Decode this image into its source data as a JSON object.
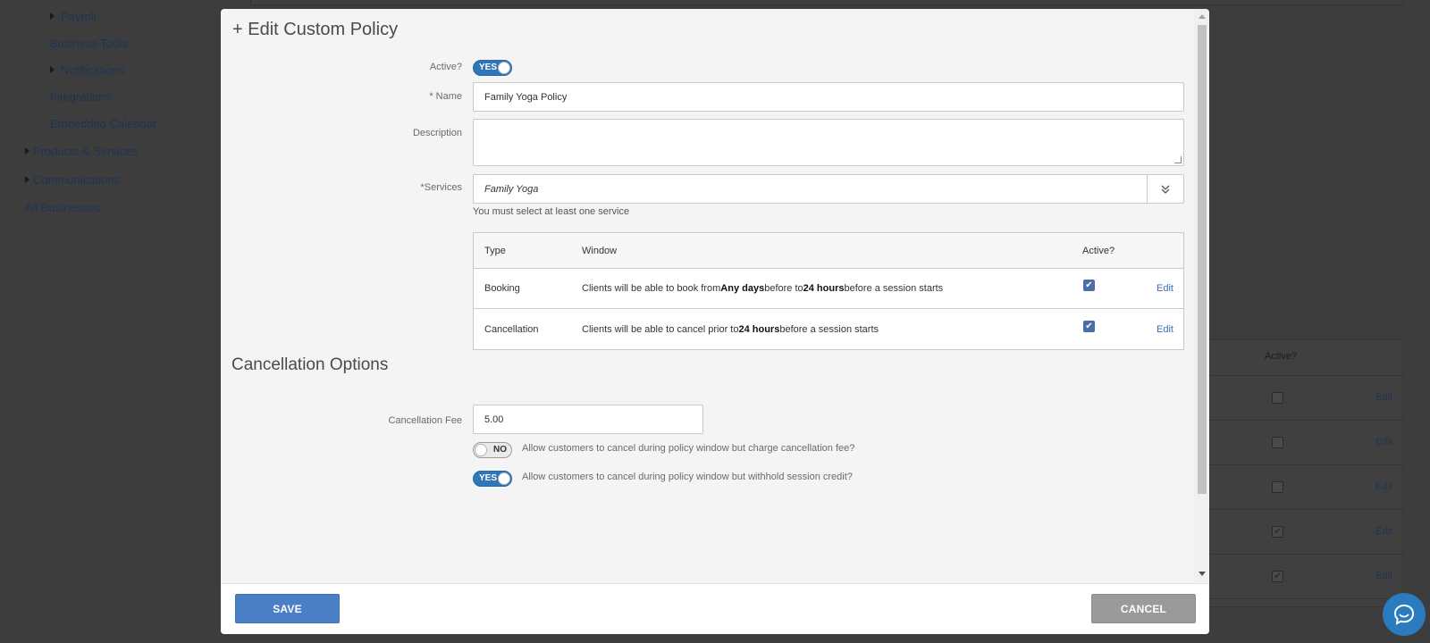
{
  "background": {
    "nav_items": [
      {
        "label": "Payroll",
        "expandable": true
      },
      {
        "label": "Business Tools",
        "expandable": false
      },
      {
        "label": "Notifications",
        "expandable": true
      },
      {
        "label": "Integrations",
        "expandable": false
      },
      {
        "label": "Embedded Calendar",
        "expandable": false
      },
      {
        "label": "Products & Services",
        "expandable": true
      },
      {
        "label": "Communications",
        "expandable": true
      },
      {
        "label": "All Businesses",
        "expandable": false
      }
    ],
    "table_header": "Active?",
    "rows": [
      {
        "checked": false,
        "edit": "Edit"
      },
      {
        "checked": false,
        "edit": "Edit"
      },
      {
        "checked": false,
        "edit": "Edit"
      },
      {
        "checked": true,
        "edit": "Edit"
      },
      {
        "checked": true,
        "edit": "Edit"
      }
    ]
  },
  "modal": {
    "title": "+ Edit Custom Policy",
    "active": {
      "label": "Active?",
      "value": "YES",
      "on": true
    },
    "name": {
      "label": "* Name",
      "value": "Family Yoga Policy"
    },
    "description": {
      "label": "Description",
      "value": ""
    },
    "services": {
      "label": "*Services",
      "value": "Family Yoga",
      "hint": "You must select at least one service",
      "dropdown_icon": "double-chevron-down-icon"
    },
    "policy_table": {
      "headers": {
        "type": "Type",
        "window": "Window",
        "active": "Active?"
      },
      "rows": [
        {
          "type": "Booking",
          "window_parts": [
            "Clients will be able to book from ",
            "Any days",
            " before to ",
            "24 hours",
            " before a session starts"
          ],
          "active": true,
          "edit": "Edit"
        },
        {
          "type": "Cancellation",
          "window_parts": [
            "Clients will be able to cancel prior to ",
            "24 hours",
            " before a session starts"
          ],
          "active": true,
          "edit": "Edit"
        }
      ]
    },
    "cancellation": {
      "section_title": "Cancellation Options",
      "fee_label": "Cancellation Fee",
      "fee_value": "5.00",
      "options": [
        {
          "toggle": "NO",
          "on": false,
          "text": "Allow customers to cancel during policy window but charge cancellation fee?"
        },
        {
          "toggle": "YES",
          "on": true,
          "text": "Allow customers to cancel during policy window but withhold session credit?"
        }
      ]
    },
    "footer": {
      "save": "SAVE",
      "cancel": "CANCEL"
    }
  },
  "colors": {
    "primary": "#4a7fc5",
    "toggle_on": "#2f76b8",
    "link": "#3a6db5",
    "overlay": "#3d3d3d"
  }
}
